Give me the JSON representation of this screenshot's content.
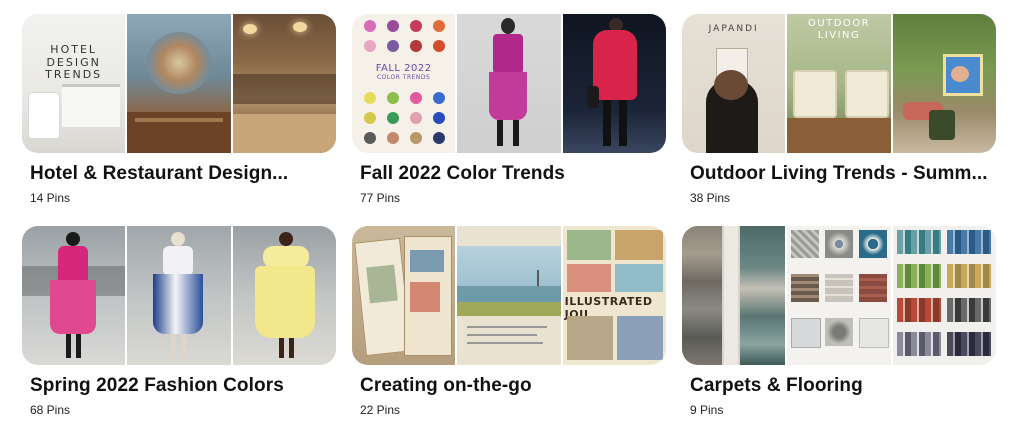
{
  "boards": [
    {
      "title": "Hotel & Restaurant Design...",
      "pins": "14 Pins",
      "cover_text": "HOTEL\nDESIGN\nTRENDS",
      "images": [
        "hotel-room",
        "restaurant-mural",
        "restaurant-interior"
      ]
    },
    {
      "title": "Fall 2022 Color Trends",
      "pins": "77 Pins",
      "cover_text": "FALL 2022",
      "cover_subtext": "COLOR TRENDS",
      "images": [
        "color-palette",
        "magenta-suit-model",
        "red-coat-model"
      ]
    },
    {
      "title": "Outdoor Living Trends - Summ...",
      "pins": "38 Pins",
      "cover_text": "JAPANDI",
      "cover_text_2": "OUTDOOR\nLIVING",
      "images": [
        "japandi-wall",
        "outdoor-mugs",
        "patio-garden"
      ]
    },
    {
      "title": "Spring 2022 Fashion Colors",
      "pins": "68 Pins",
      "images": [
        "pink-dress-model",
        "blue-white-dress-model",
        "yellow-dress-model"
      ]
    },
    {
      "title": "Creating on-the-go",
      "pins": "22 Pins",
      "cover_text": "ILLUSTRATED JOU",
      "images": [
        "sketchbook-journal",
        "watercolor-landscape",
        "illustrated-journal"
      ]
    },
    {
      "title": "Carpets & Flooring",
      "pins": "9 Pins",
      "images": [
        "carpet-samples",
        "tile-samples",
        "mosaic-swatches"
      ]
    }
  ],
  "colors": {
    "title_text": "#111111",
    "count_text": "#222222",
    "background": "#ffffff"
  }
}
